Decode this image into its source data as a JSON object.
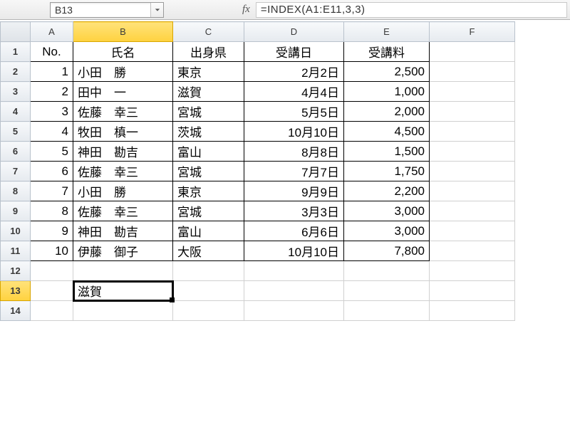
{
  "namebox": {
    "value": "B13"
  },
  "formula_bar": {
    "label": "fx",
    "formula": "=INDEX(A1:E11,3,3)"
  },
  "columns": [
    "A",
    "B",
    "C",
    "D",
    "E",
    "F"
  ],
  "selected_column": "B",
  "selected_row": 13,
  "row_count": 14,
  "chart_data": {
    "type": "table",
    "headers": {
      "A": "No.",
      "B": "氏名",
      "C": "出身県",
      "D": "受講日",
      "E": "受講料"
    },
    "rows": [
      {
        "A": "1",
        "B": "小田　勝",
        "C": "東京",
        "D": "2月2日",
        "E": "2,500"
      },
      {
        "A": "2",
        "B": "田中　一",
        "C": "滋賀",
        "D": "4月4日",
        "E": "1,000"
      },
      {
        "A": "3",
        "B": "佐藤　幸三",
        "C": "宮城",
        "D": "5月5日",
        "E": "2,000"
      },
      {
        "A": "4",
        "B": "牧田　槙一",
        "C": "茨城",
        "D": "10月10日",
        "E": "4,500"
      },
      {
        "A": "5",
        "B": "神田　勘吉",
        "C": "富山",
        "D": "8月8日",
        "E": "1,500"
      },
      {
        "A": "6",
        "B": "佐藤　幸三",
        "C": "宮城",
        "D": "7月7日",
        "E": "1,750"
      },
      {
        "A": "7",
        "B": "小田　勝",
        "C": "東京",
        "D": "9月9日",
        "E": "2,200"
      },
      {
        "A": "8",
        "B": "佐藤　幸三",
        "C": "宮城",
        "D": "3月3日",
        "E": "3,000"
      },
      {
        "A": "9",
        "B": "神田　勘吉",
        "C": "富山",
        "D": "6月6日",
        "E": "3,000"
      },
      {
        "A": "10",
        "B": "伊藤　御子",
        "C": "大阪",
        "D": "10月10日",
        "E": "7,800"
      }
    ]
  },
  "result_cell": {
    "address": "B13",
    "value": "滋賀"
  }
}
